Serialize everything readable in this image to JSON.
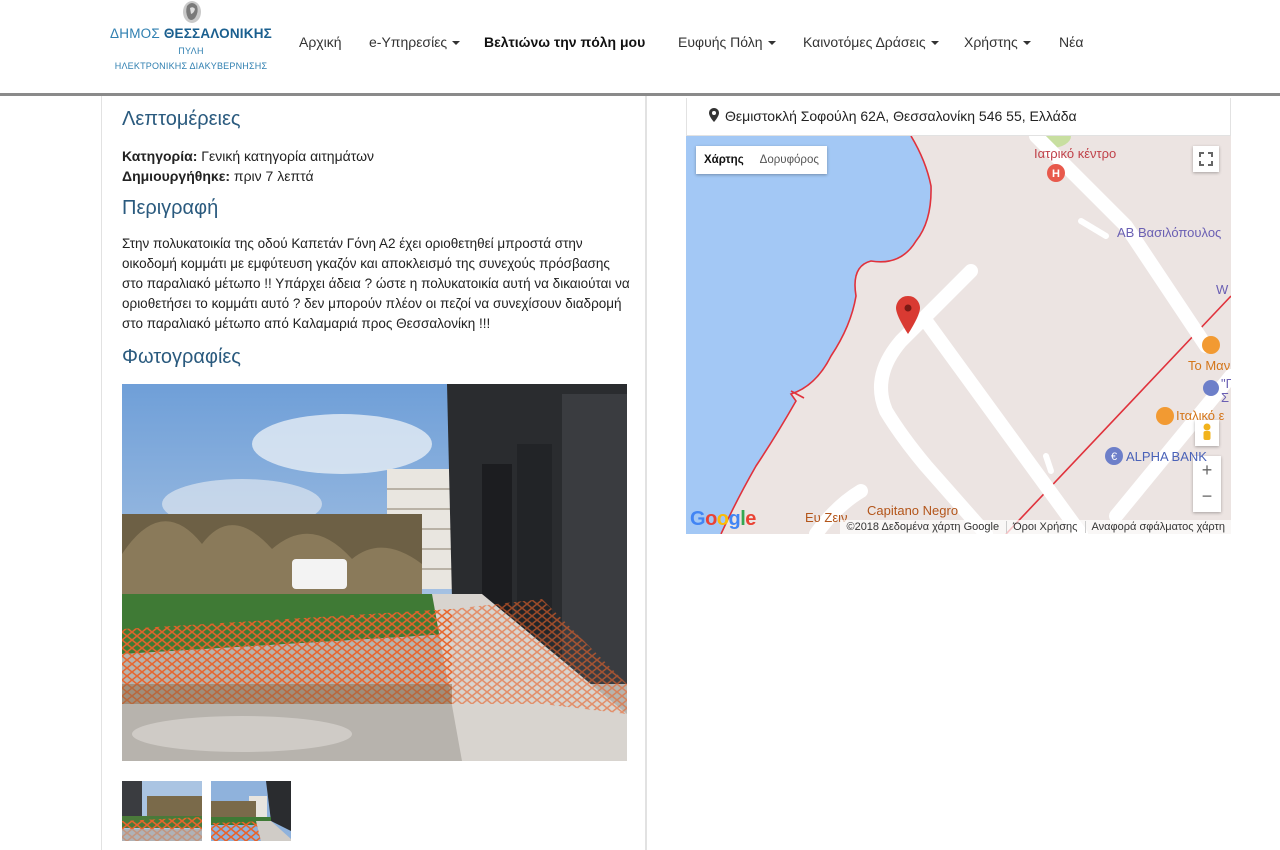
{
  "header": {
    "logo": {
      "line1_prefix": "ΔΗΜΟΣ",
      "line1_bold": "ΘΕΣΣΑΛΟΝΙΚΗΣ",
      "line2": "ΠΥΛΗ",
      "line3": "ΗΛΕΚΤΡΟΝΙΚΗΣ ΔΙΑΚΥΒΕΡΝΗΣΗΣ"
    },
    "nav": [
      {
        "label": "Αρχική",
        "dropdown": false,
        "active": false
      },
      {
        "label": "e-Υπηρεσίες",
        "dropdown": true,
        "active": false
      },
      {
        "label": "Βελτιώνω την πόλη μου",
        "dropdown": false,
        "active": true
      },
      {
        "label": "Ευφυής Πόλη",
        "dropdown": true,
        "active": false
      },
      {
        "label": "Καινοτόμες Δράσεις",
        "dropdown": true,
        "active": false
      },
      {
        "label": "Χρήστης",
        "dropdown": true,
        "active": false
      },
      {
        "label": "Νέα",
        "dropdown": false,
        "active": false
      }
    ]
  },
  "details": {
    "title": "Λεπτομέρειες",
    "category_label": "Κατηγορία:",
    "category_value": "Γενική κατηγορία αιτημάτων",
    "created_label": "Δημιουργήθηκε:",
    "created_value": "πριν 7 λεπτά"
  },
  "description": {
    "title": "Περιγραφή",
    "text": "Στην πολυκατοικία της οδού Καπετάν Γόνη Α2 έχει οριοθετηθεί μπροστά στην οικοδομή κομμάτι με εμφύτευση γκαζόν και αποκλεισμό της συνεχούς πρόσβασης στο παραλιακό μέτωπο !! Υπάρχει άδεια ? ώστε η πολυκατοικία αυτή να δικαιούται να οριοθετήσει το κομμάτι αυτό ? δεν μπορούν πλέον οι πεζοί να συνεχίσουν διαδρομή στο παραλιακό μέτωπο από Καλαμαριά προς Θεσσαλονίκη !!!"
  },
  "photos": {
    "title": "Φωτογραφίες",
    "thumbnail_count_shown": 2
  },
  "map": {
    "address": "Θεμιστοκλή Σοφούλη 62Α, Θεσσαλονίκη 546 55, Ελλάδα",
    "type_map": "Χάρτης",
    "type_satellite": "Δορυφόρος",
    "labels": {
      "medical": "Ιατρικό κέντρο",
      "supermarket": "ΑΒ Βασιλόπουλος",
      "bank": "ALPHA BANK",
      "capitano": "Capitano Negro",
      "euzein": "Ευ Ζειν",
      "to_mav": "Το Μαν",
      "italiko": "Ιταλικό ε",
      "edge_w": "W",
      "edge_quote": "\"Γ",
      "edge_sigma": "Σ"
    },
    "footer": {
      "copyright": "©2018 Δεδομένα χάρτη Google",
      "terms": "Όροι Χρήσης",
      "report": "Αναφορά σφάλματος χάρτη"
    },
    "google_logo": "Google",
    "zoom_in": "+",
    "zoom_out": "−"
  },
  "colors": {
    "accent_title": "#2a5a7e",
    "logo_blue": "#2f7fb0",
    "sea": "#a3c8f5",
    "land": "#ece4e2",
    "boundary": "#e0323c",
    "marker": "#d93a32"
  }
}
